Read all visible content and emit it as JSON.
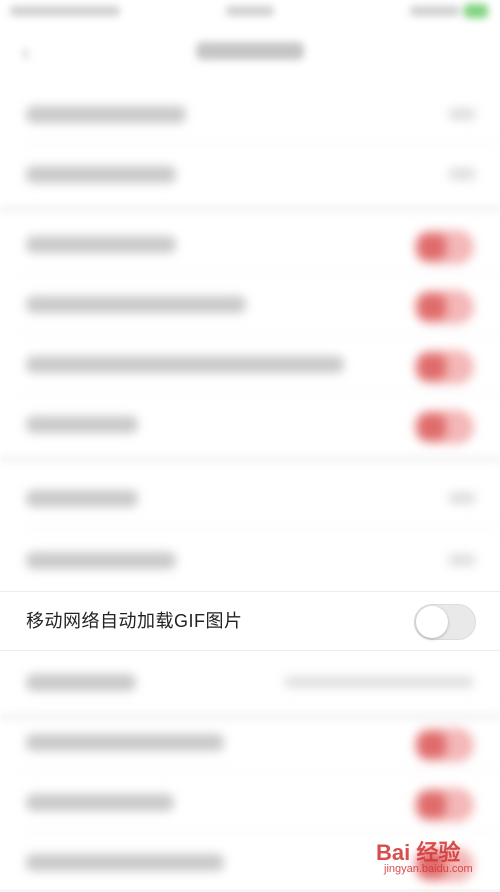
{
  "settings": {
    "gif_row": {
      "label": "移动网络自动加载GIF图片",
      "toggle_on": false
    }
  },
  "watermark": {
    "brand": "Bai 经验",
    "url": "jingyan.baidu.com"
  },
  "colors": {
    "accent_red": "#e06c6c",
    "switch_off": "#e9e9e9"
  }
}
